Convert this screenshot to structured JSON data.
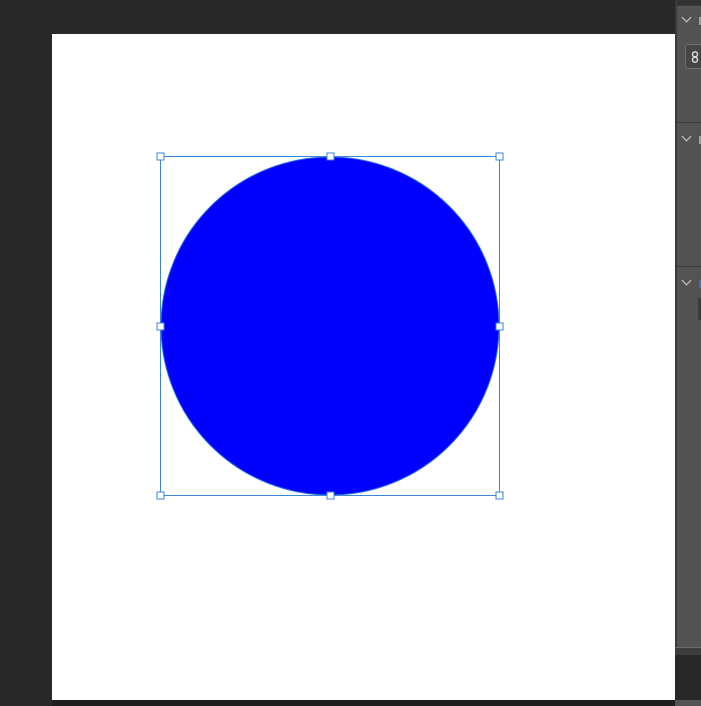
{
  "document": {
    "background_color": "#ffffff",
    "workspace_color": "#282828"
  },
  "shape": {
    "type": "ellipse",
    "fill_color": "#0000ff",
    "stroke_color": "#2b6fd6",
    "selection_color": "#3a86d8",
    "selected": true
  },
  "panel": {
    "background_color": "#535353",
    "sections": [
      {
        "icon": "chevron-down-icon",
        "expanded": true
      },
      {
        "icon": "chevron-down-icon",
        "expanded": true
      },
      {
        "icon": "chevron-down-icon",
        "expanded": true
      }
    ],
    "link_icon": "link-icon"
  }
}
